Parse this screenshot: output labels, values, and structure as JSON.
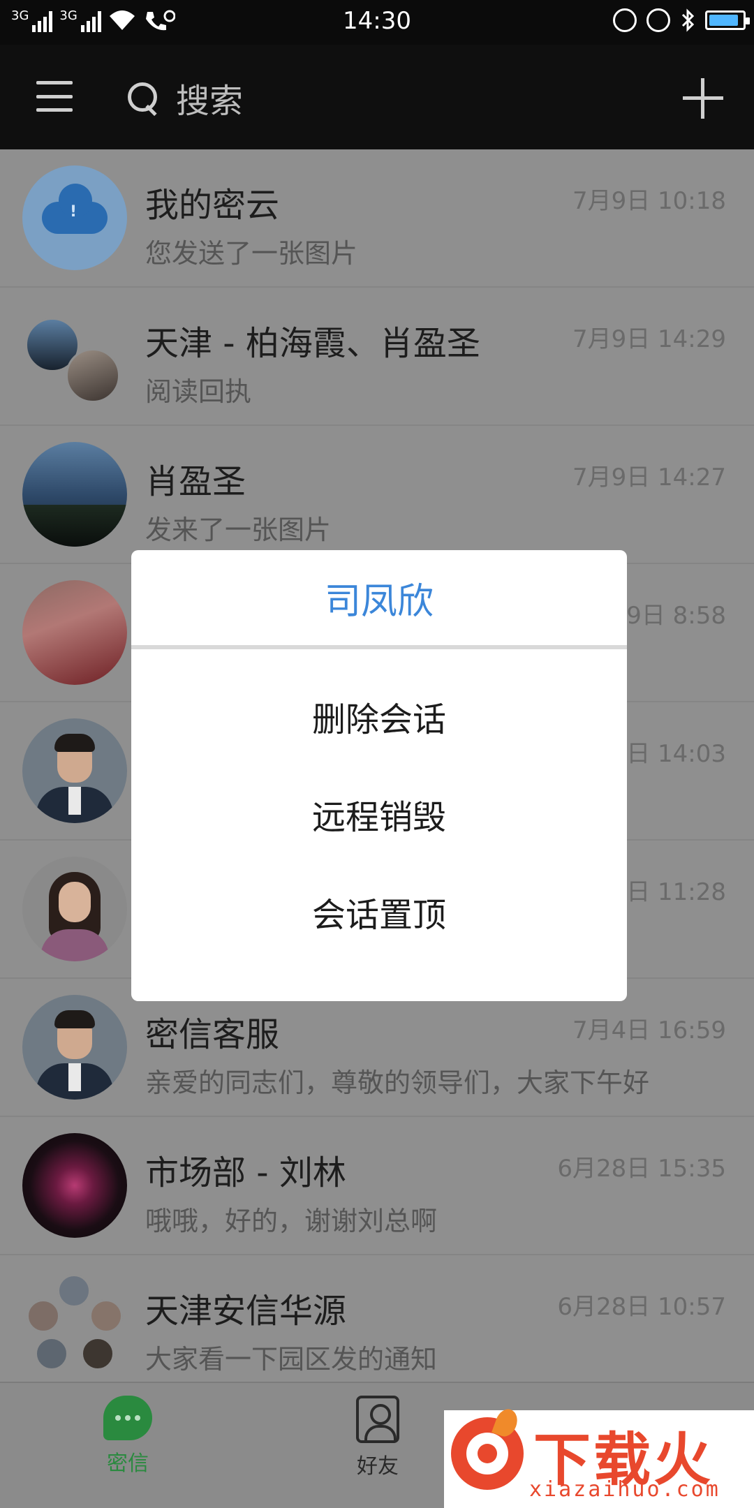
{
  "status_bar": {
    "time": "14:30",
    "signal_label": "3G",
    "battery_level": 0.9,
    "icons": [
      "signal-icon",
      "signal-icon",
      "wifi-icon",
      "hd-call-icon",
      "alarm-icon",
      "alarm-clock-icon",
      "bluetooth-icon",
      "battery-icon"
    ]
  },
  "header": {
    "search_placeholder": "搜索",
    "icons": [
      "menu-icon",
      "search-icon",
      "plus-icon"
    ]
  },
  "conversations": [
    {
      "name": "我的密云",
      "time": "7月9日 10:18",
      "preview": "您发送了一张图片"
    },
    {
      "name": "天津 - 柏海霞、肖盈圣",
      "time": "7月9日 14:29",
      "preview": "阅读回执"
    },
    {
      "name": "肖盈圣",
      "time": "7月9日 14:27",
      "preview": "发来了一张图片"
    },
    {
      "name": "",
      "time": "9日 8:58",
      "preview": ""
    },
    {
      "name": "",
      "time": "日 14:03",
      "preview": ""
    },
    {
      "name": "",
      "time": "日 11:28",
      "preview": ""
    },
    {
      "name": "密信客服",
      "time": "7月4日 16:59",
      "preview": "亲爱的同志们，尊敬的领导们，大家下午好"
    },
    {
      "name": "市场部 - 刘林",
      "time": "6月28日 15:35",
      "preview": "哦哦，好的，谢谢刘总啊"
    },
    {
      "name": "天津安信华源",
      "time": "6月28日 10:57",
      "preview": "大家看一下园区发的通知"
    }
  ],
  "dialog": {
    "title": "司凤欣",
    "items": [
      "删除会话",
      "远程销毁",
      "会话置顶"
    ]
  },
  "bottom_nav": {
    "items": [
      {
        "label": "密信",
        "icon": "chat-bubble-icon",
        "active": true
      },
      {
        "label": "好友",
        "icon": "contacts-icon",
        "active": false
      }
    ]
  },
  "watermark": {
    "title": "下载火",
    "url": "xiazaihuo.com"
  },
  "colors": {
    "accent_blue": "#3b86d9",
    "active_green": "#2a8a3f",
    "header_bg": "#0f0f0f",
    "overlay_gray": "#8f8f8f",
    "watermark_red": "#e8482d"
  }
}
